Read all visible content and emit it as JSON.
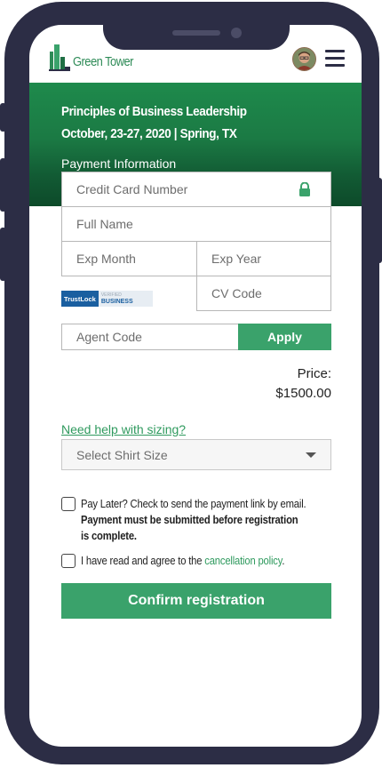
{
  "app": {
    "logo_text": "Green Tower"
  },
  "course": {
    "title": "Principles of Business Leadership",
    "meta": "October, 23-27, 2020 | Spring, TX"
  },
  "payment": {
    "heading": "Payment Information",
    "card_number_placeholder": "Credit Card Number",
    "full_name_placeholder": "Full Name",
    "exp_month_placeholder": "Exp Month",
    "exp_year_placeholder": "Exp Year",
    "cv_code_placeholder": "CV Code",
    "trust_badge": {
      "brand": "TrustLock",
      "label": "BUSINESS",
      "small": "VERIFIED"
    }
  },
  "agent": {
    "placeholder": "Agent Code",
    "apply_label": "Apply"
  },
  "price": {
    "label": "Price:",
    "value": "$1500.00"
  },
  "sizing": {
    "help_link": "Need help with sizing?",
    "select_placeholder": "Select Shirt Size"
  },
  "pay_later": {
    "line1": "Pay Later? Check to send the payment link by email.",
    "line2": "Payment must be submitted before registration",
    "line3": "is complete."
  },
  "agree": {
    "text": "I have read and agree to the ",
    "link": "cancellation policy",
    "suffix": "."
  },
  "confirm_label": "Confirm registration",
  "colors": {
    "brand_green": "#3aa26b",
    "frame": "#2c2d45",
    "banner_dark": "#0d4a2a"
  }
}
